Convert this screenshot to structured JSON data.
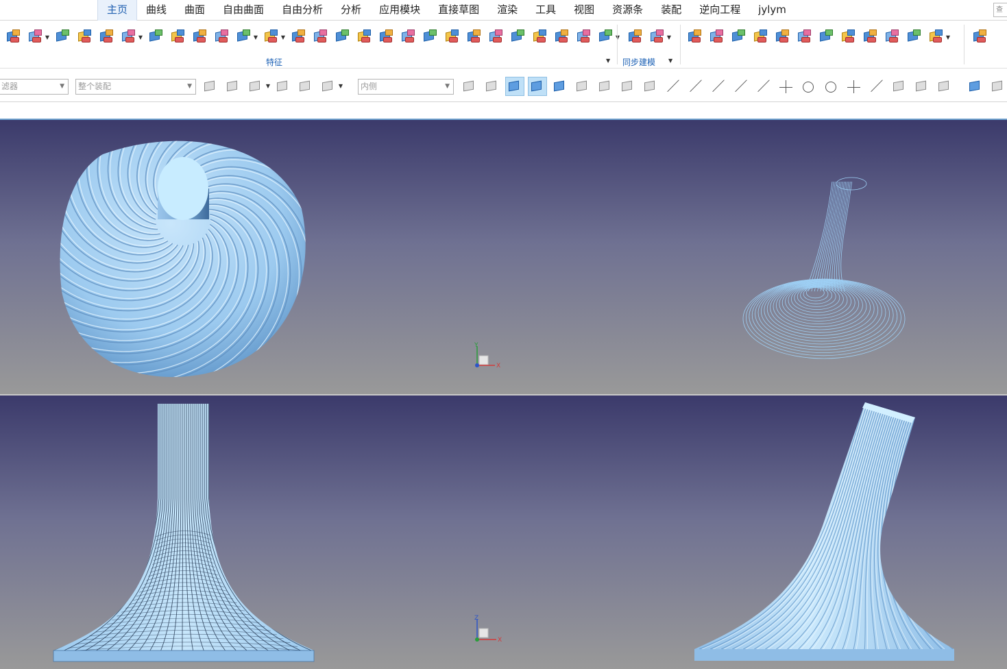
{
  "menu": {
    "tabs": [
      "主页",
      "曲线",
      "曲面",
      "自由曲面",
      "自由分析",
      "分析",
      "应用模块",
      "直接草图",
      "渲染",
      "工具",
      "视图",
      "资源条",
      "装配",
      "逆向工程",
      "jylym"
    ],
    "active_tab": "主页",
    "search_placeholder": "查"
  },
  "ribbon": {
    "groups": [
      {
        "label": "特征"
      },
      {
        "label": "同步建模"
      }
    ]
  },
  "selection_bar": {
    "filter_label": "滤器",
    "scope_label": "整个装配",
    "face_rule_label": "内侧"
  },
  "viewports": {
    "top_triad": {
      "vertical_axis": "Y",
      "horizontal_axis": "X"
    },
    "bottom_triad": {
      "vertical_axis": "Z",
      "horizontal_axis": "X"
    }
  },
  "colors": {
    "accent": "#2060b0",
    "model_fill": "#a8d2f2",
    "model_dark": "#5b8fc0",
    "viewport_top": "#3b3a6b",
    "viewport_bottom": "#999999"
  }
}
